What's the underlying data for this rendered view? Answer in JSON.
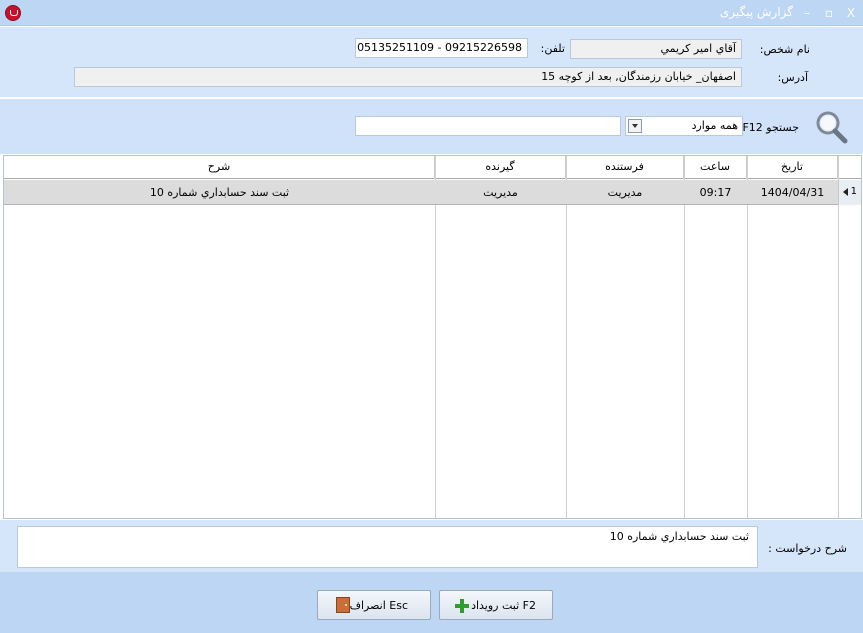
{
  "window": {
    "title": "گزارش پیگیری",
    "minimize": "–",
    "maximize": "▫",
    "close": "X"
  },
  "person": {
    "name_label": "نام شخص:",
    "name_value": "آقاي امير  كريمي",
    "phone_label": "تلفن:",
    "phone_value": "09215226598 - 05135251109",
    "address_label": "آدرس:",
    "address_value": "اصفهان_ خيابان رزمندگان, بعد از كوچه 15"
  },
  "search": {
    "label": "جستجو F12",
    "filter_value": "همه موارد",
    "query": ""
  },
  "grid": {
    "columns": [
      "تاریخ",
      "ساعت",
      "فرستنده",
      "گیرنده",
      "شرح"
    ],
    "rows": [
      {
        "num": "1",
        "date": "1404/04/31",
        "time": "09:17",
        "sender": "مديريت",
        "receiver": "مديريت",
        "desc": "ثبت سند حسابداري شماره 10"
      }
    ]
  },
  "request": {
    "label": "شرح درخواست :",
    "value": "ثبت سند حسابداري شماره 10"
  },
  "buttons": {
    "add_event": "F2 ثبت رويداد",
    "cancel": "Esc انصراف"
  },
  "colors": {
    "title_bar": "#bdd6f4",
    "panel": "#d6e6fa",
    "selected_row": "#dcdcdc",
    "plus": "#2e9d2e"
  }
}
